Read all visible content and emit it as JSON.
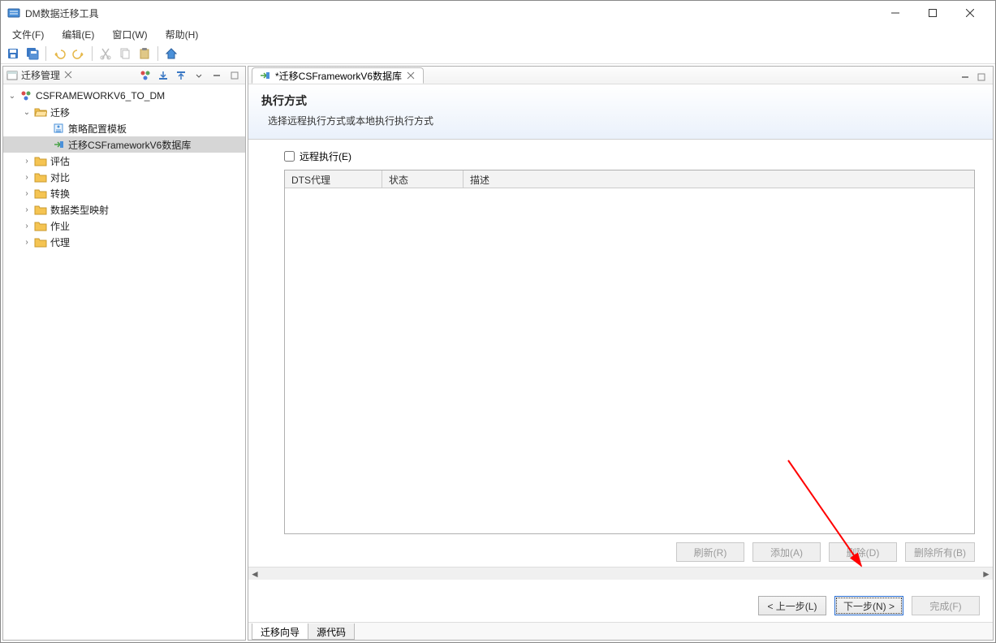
{
  "window": {
    "title": "DM数据迁移工具"
  },
  "menu": {
    "file": "文件(F)",
    "edit": "编辑(E)",
    "window": "窗口(W)",
    "help": "帮助(H)"
  },
  "sidebar": {
    "title": "迁移管理",
    "root": "CSFRAMEWORKV6_TO_DM",
    "migrate": "迁移",
    "template": "策略配置模板",
    "migrate_db": "迁移CSFrameworkV6数据库",
    "evaluate": "评估",
    "compare": "对比",
    "convert": "转换",
    "type_map": "数据类型映射",
    "job": "作业",
    "agent": "代理"
  },
  "editor": {
    "tab_title": "*迁移CSFrameworkV6数据库",
    "wizard_title": "执行方式",
    "wizard_sub": "选择远程执行方式或本地执行执行方式",
    "remote_label": "远程执行(E)",
    "col_proxy": "DTS代理",
    "col_status": "状态",
    "col_desc": "描述",
    "btn_refresh": "刷新(R)",
    "btn_add": "添加(A)",
    "btn_delete": "删除(D)",
    "btn_delete_all": "删除所有(B)",
    "btn_prev": "< 上一步(L)",
    "btn_next": "下一步(N) >",
    "btn_finish": "完成(F)",
    "bottom_wizard": "迁移向导",
    "bottom_source": "源代码"
  }
}
